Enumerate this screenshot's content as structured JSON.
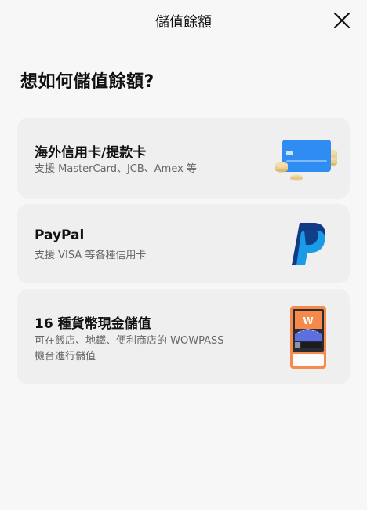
{
  "header": {
    "title": "儲值餘額",
    "close_icon": "close-icon"
  },
  "heading": "想如何儲值餘額?",
  "options": [
    {
      "title": "海外信用卡/提款卡",
      "description_lines": [
        "支援 MasterCard、JCB、Amex 等"
      ],
      "icon": "credit-card-coins-icon"
    },
    {
      "title": "PayPal",
      "description_lines": [
        "支援 VISA 等各種信用卡"
      ],
      "icon": "paypal-icon"
    },
    {
      "title": "16 種貨幣現金儲值",
      "description_lines": [
        "可在飯店、地鐵、便利商店的 WOWPASS",
        "機台進行儲值"
      ],
      "icon": "wowpass-kiosk-icon",
      "kiosk_letter": "W"
    }
  ],
  "colors": {
    "background": "#f7f7f7",
    "card": "#efefef",
    "card_blue": "#2f8cf3",
    "coin": "#e9cf93",
    "paypal_dark": "#113984",
    "paypal_light": "#1a9be6",
    "kiosk_orange": "#f58a4b"
  }
}
